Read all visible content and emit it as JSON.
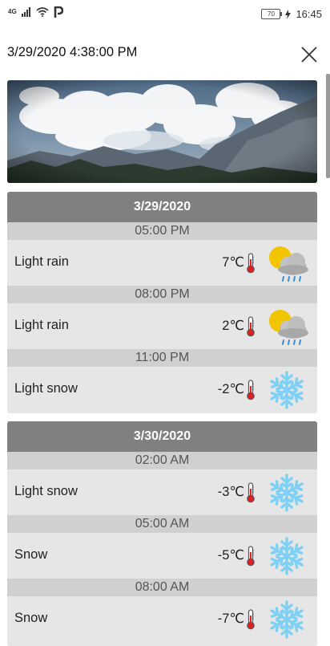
{
  "status_bar": {
    "network": "4G",
    "battery": "70",
    "time": "16:45"
  },
  "header": {
    "title": "3/29/2020 4:38:00 PM"
  },
  "days": [
    {
      "date": "3/29/2020",
      "slots": [
        {
          "time": "05:00 PM",
          "condition": "Light rain",
          "temp": "7℃",
          "icon": "partly-cloudy-rain-icon"
        },
        {
          "time": "08:00 PM",
          "condition": "Light rain",
          "temp": "2℃",
          "icon": "partly-cloudy-rain-icon"
        },
        {
          "time": "11:00 PM",
          "condition": "Light snow",
          "temp": "-2℃",
          "icon": "snowflake-icon"
        }
      ]
    },
    {
      "date": "3/30/2020",
      "slots": [
        {
          "time": "02:00 AM",
          "condition": "Light snow",
          "temp": "-3℃",
          "icon": "snowflake-icon"
        },
        {
          "time": "05:00 AM",
          "condition": "Snow",
          "temp": "-5℃",
          "icon": "snowflake-icon"
        },
        {
          "time": "08:00 AM",
          "condition": "Snow",
          "temp": "-7℃",
          "icon": "snowflake-icon"
        }
      ]
    }
  ],
  "colors": {
    "day_header": "#808080",
    "time_strip": "#d0d0d0",
    "row_bg": "#e6e6e6",
    "snow_icon": "#7fd0f5",
    "sun": "#f2c500"
  }
}
